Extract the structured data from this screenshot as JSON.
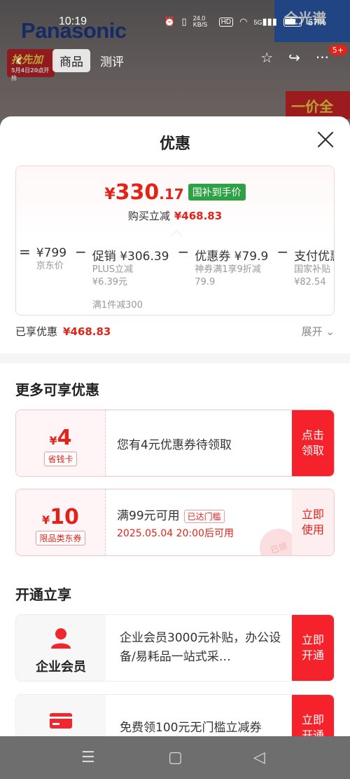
{
  "status_bar": {
    "time": "10:19",
    "net_speed": "24.0 KB/S",
    "hd": "HD",
    "signal": "5G",
    "battery": "67%"
  },
  "background": {
    "brand": "Panasonic",
    "banner_right": "全光谱",
    "promo_left_title": "抢先加",
    "promo_left_sub": "5月4日20点开抢",
    "promo_right": "一价全包",
    "tabs": [
      "商品",
      "测评"
    ],
    "cart_badge": "5+"
  },
  "sheet": {
    "title": "优惠",
    "final_price": {
      "currency": "¥",
      "integer": "330",
      "decimal": ".17",
      "tag": "国补到手价"
    },
    "reduce_label": "购买立减",
    "reduce_amount": "¥468.83",
    "breakdown": [
      {
        "op": "=",
        "main": "¥799",
        "sub": "京东价",
        "sub2": "",
        "extra": ""
      },
      {
        "op": "−",
        "main": "促销 ¥306.39",
        "sub": "PLUS立减",
        "sub2": "¥6.39元",
        "extra": "满1件减300"
      },
      {
        "op": "−",
        "main": "优惠券 ¥79.9",
        "sub": "神券满1享9折减",
        "sub2": "79.9",
        "extra": ""
      },
      {
        "op": "−",
        "main": "支付优惠",
        "sub": "国家补贴",
        "sub2": "¥82.54",
        "extra": ""
      }
    ],
    "enjoyed_label": "已享优惠",
    "enjoyed_amount": "¥468.83",
    "expand_label": "展开"
  },
  "more_offers": {
    "title": "更多可享优惠",
    "coupons": [
      {
        "currency": "¥",
        "amount": "4",
        "label": "省钱卡",
        "desc": "您有4元优惠券待领取",
        "threshold": "",
        "time": "",
        "button": "点击领取"
      },
      {
        "currency": "¥",
        "amount": "10",
        "label": "限品类东券",
        "desc": "满99元可用",
        "threshold": "已达门槛",
        "time": "2025.05.04 20:00后可用",
        "button": "立即使用",
        "stamp": "已领"
      }
    ]
  },
  "membership": {
    "title": "开通立享",
    "cards": [
      {
        "name": "企业会员",
        "desc": "企业会员3000元补贴，办公设备/易耗品一站式采…",
        "button": "立即开通"
      },
      {
        "name": "",
        "desc": "免费领100元无门槛立减券",
        "button": "立即开通"
      }
    ]
  },
  "colors": {
    "accent": "#e2231a",
    "button_red": "#f6222b",
    "green_tag": "#2ea146"
  }
}
